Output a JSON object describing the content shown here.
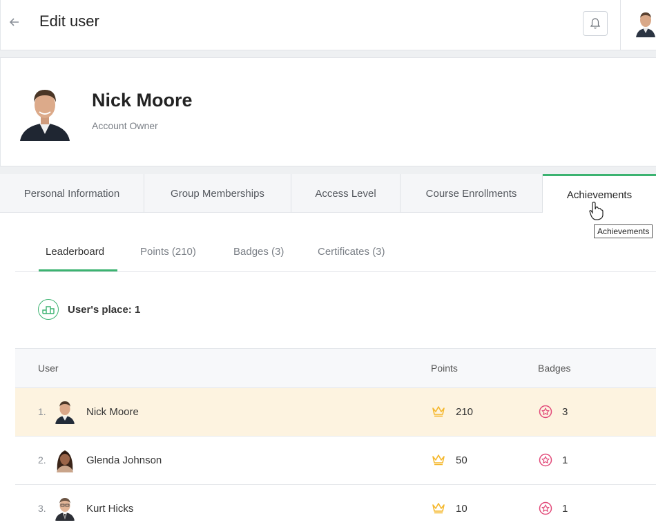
{
  "header": {
    "title": "Edit user",
    "back_icon": "arrow-left-icon",
    "bell_icon": "bell-icon"
  },
  "profile": {
    "name": "Nick Moore",
    "role": "Account Owner"
  },
  "tabs": [
    {
      "label": "Personal Information",
      "active": false
    },
    {
      "label": "Group Memberships",
      "active": false
    },
    {
      "label": "Access Level",
      "active": false
    },
    {
      "label": "Course Enrollments",
      "active": false
    },
    {
      "label": "Achievements",
      "active": true
    }
  ],
  "tooltip": "Achievements",
  "subtabs": [
    {
      "label": "Leaderboard",
      "active": true
    },
    {
      "label": "Points (210)",
      "active": false
    },
    {
      "label": "Badges (3)",
      "active": false
    },
    {
      "label": "Certificates (3)",
      "active": false
    }
  ],
  "place": {
    "label": "User's place: 1"
  },
  "table": {
    "headers": {
      "user": "User",
      "points": "Points",
      "badges": "Badges"
    },
    "rows": [
      {
        "rank": "1.",
        "name": "Nick Moore",
        "points": "210",
        "badges": "3",
        "highlight": true
      },
      {
        "rank": "2.",
        "name": "Glenda Johnson",
        "points": "50",
        "badges": "1",
        "highlight": false
      },
      {
        "rank": "3.",
        "name": "Kurt Hicks",
        "points": "10",
        "badges": "1",
        "highlight": false
      }
    ]
  },
  "colors": {
    "accent": "#3cb371",
    "highlight_row": "#fdf3e0",
    "crown": "#f5b82e",
    "badge": "#e24b7a"
  }
}
